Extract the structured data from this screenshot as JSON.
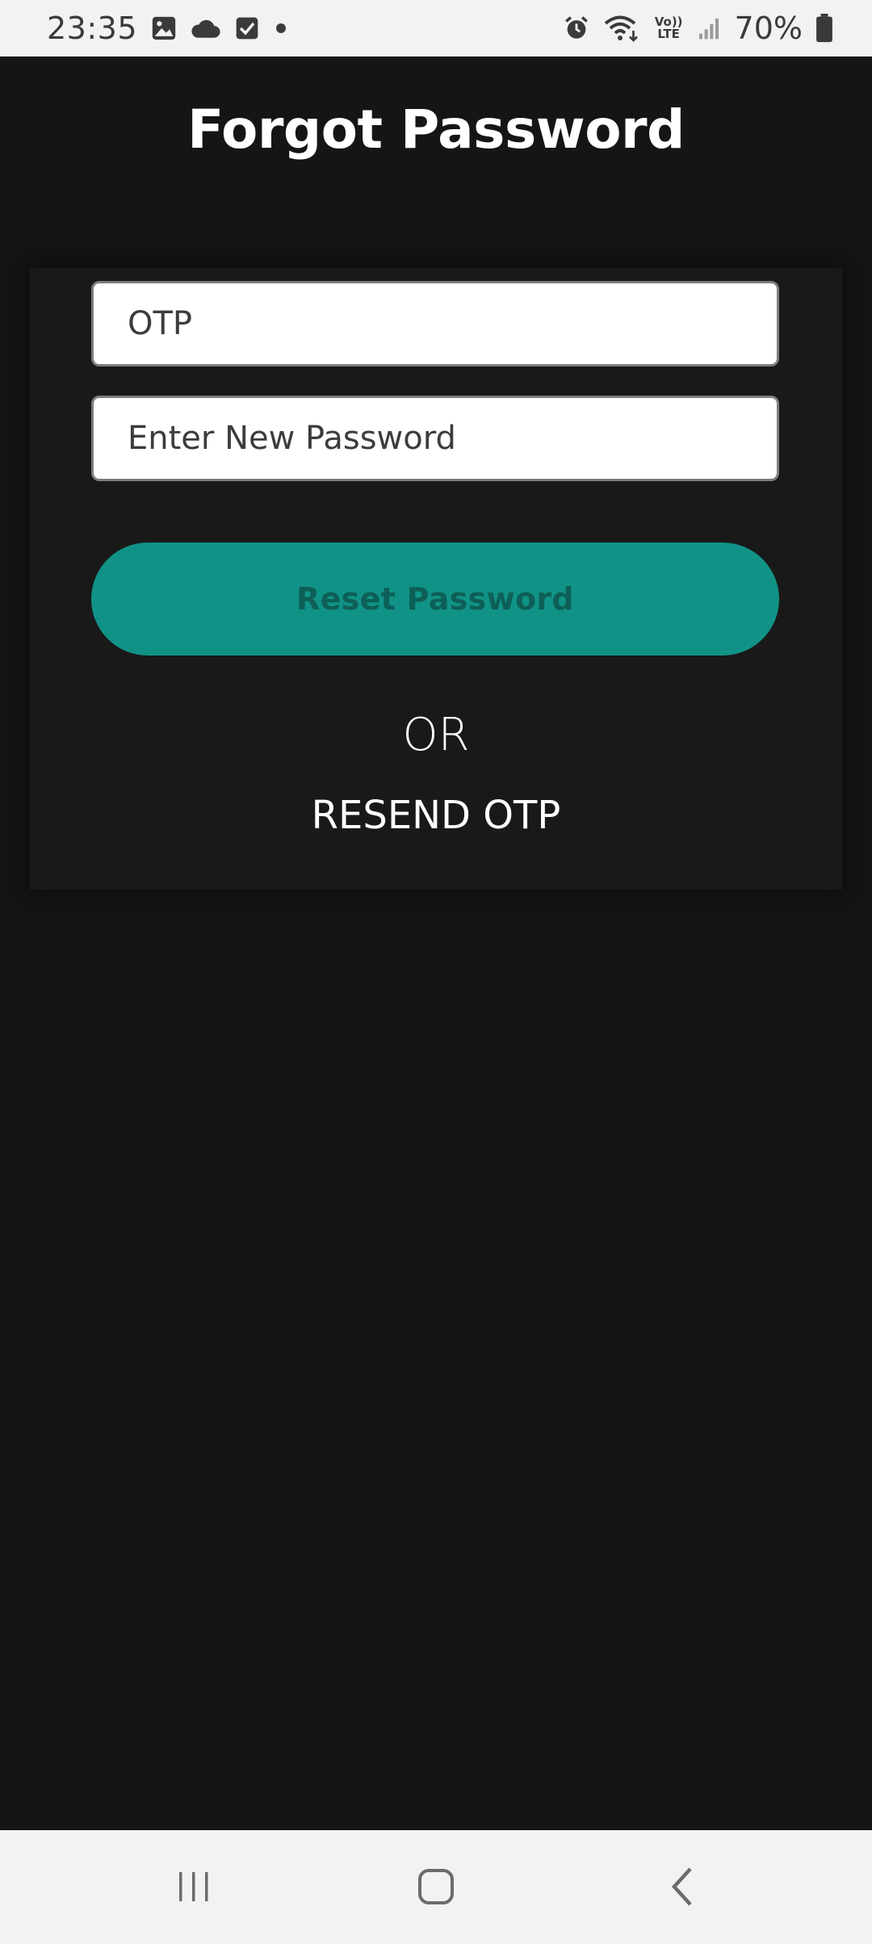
{
  "status_bar": {
    "time": "23:35",
    "left_icons": [
      "gallery-icon",
      "cloud-icon",
      "checkbox-icon",
      "dot-icon"
    ],
    "right_icons": [
      "alarm-icon",
      "wifi-icon",
      "volte-icon",
      "signal-icon",
      "battery-icon"
    ],
    "volte_label_top": "Vo))",
    "volte_label_bottom": "LTE",
    "battery": "70%"
  },
  "header": {
    "title": "Forgot Password"
  },
  "form": {
    "otp_placeholder": "OTP",
    "password_placeholder": "Enter New Password",
    "reset_label": "Reset Password",
    "or_label": "OR",
    "resend_label": "RESEND OTP",
    "accent_color": "#109386"
  },
  "nav": {
    "icons": [
      "recents-icon",
      "home-icon",
      "back-icon"
    ]
  }
}
